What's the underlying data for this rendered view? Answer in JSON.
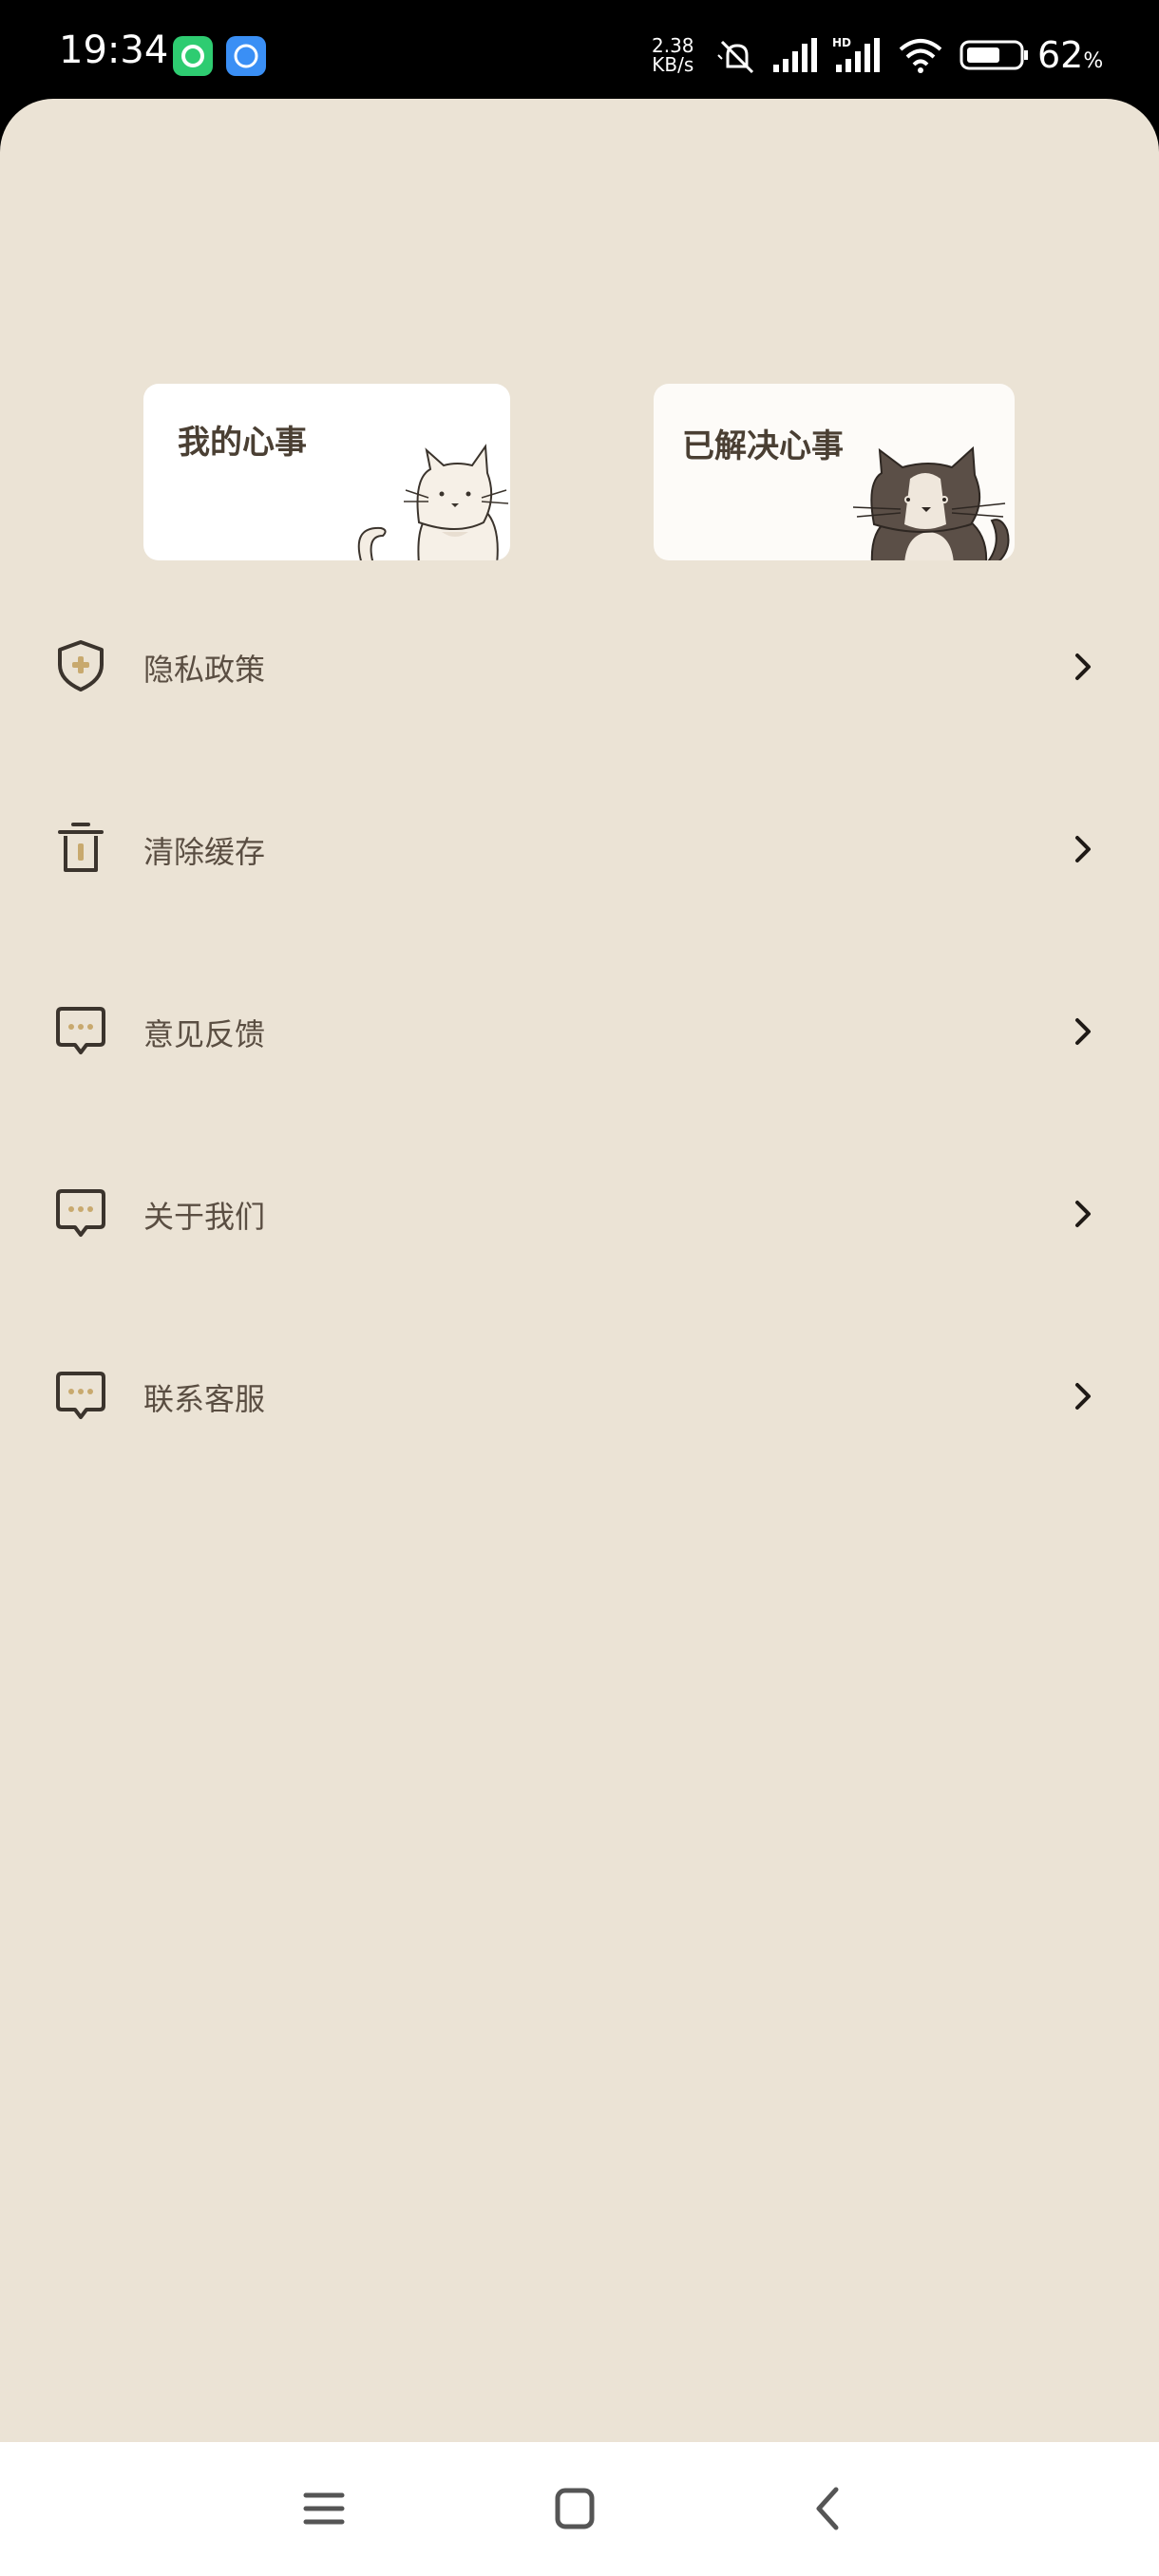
{
  "status_bar": {
    "time": "19:34",
    "net_speed_value": "2.38",
    "net_speed_unit": "KB/s",
    "battery_percent": "62",
    "battery_unit": "%",
    "icons": [
      "app-green-icon",
      "browser-icon",
      "mute-bell-icon",
      "signal-icon",
      "hd-signal-icon",
      "wifi-icon",
      "battery-icon"
    ]
  },
  "cards": [
    {
      "title": "我的心事",
      "illustration": "white-cat-illustration"
    },
    {
      "title": "已解决心事",
      "illustration": "tuxedo-cat-illustration"
    }
  ],
  "menu": [
    {
      "label": "隐私政策",
      "icon": "shield-icon"
    },
    {
      "label": "清除缓存",
      "icon": "trash-icon"
    },
    {
      "label": "意见反馈",
      "icon": "chat-bubble-icon"
    },
    {
      "label": "关于我们",
      "icon": "chat-bubble-icon"
    },
    {
      "label": "联系客服",
      "icon": "chat-bubble-icon"
    }
  ],
  "nav_bar": {
    "buttons": [
      "menu-icon",
      "home-icon",
      "back-icon"
    ]
  },
  "colors": {
    "background": "#ebe3d5",
    "accent": "#c8a96e",
    "text": "#5a4e42",
    "icon_stroke": "#3b342d"
  }
}
